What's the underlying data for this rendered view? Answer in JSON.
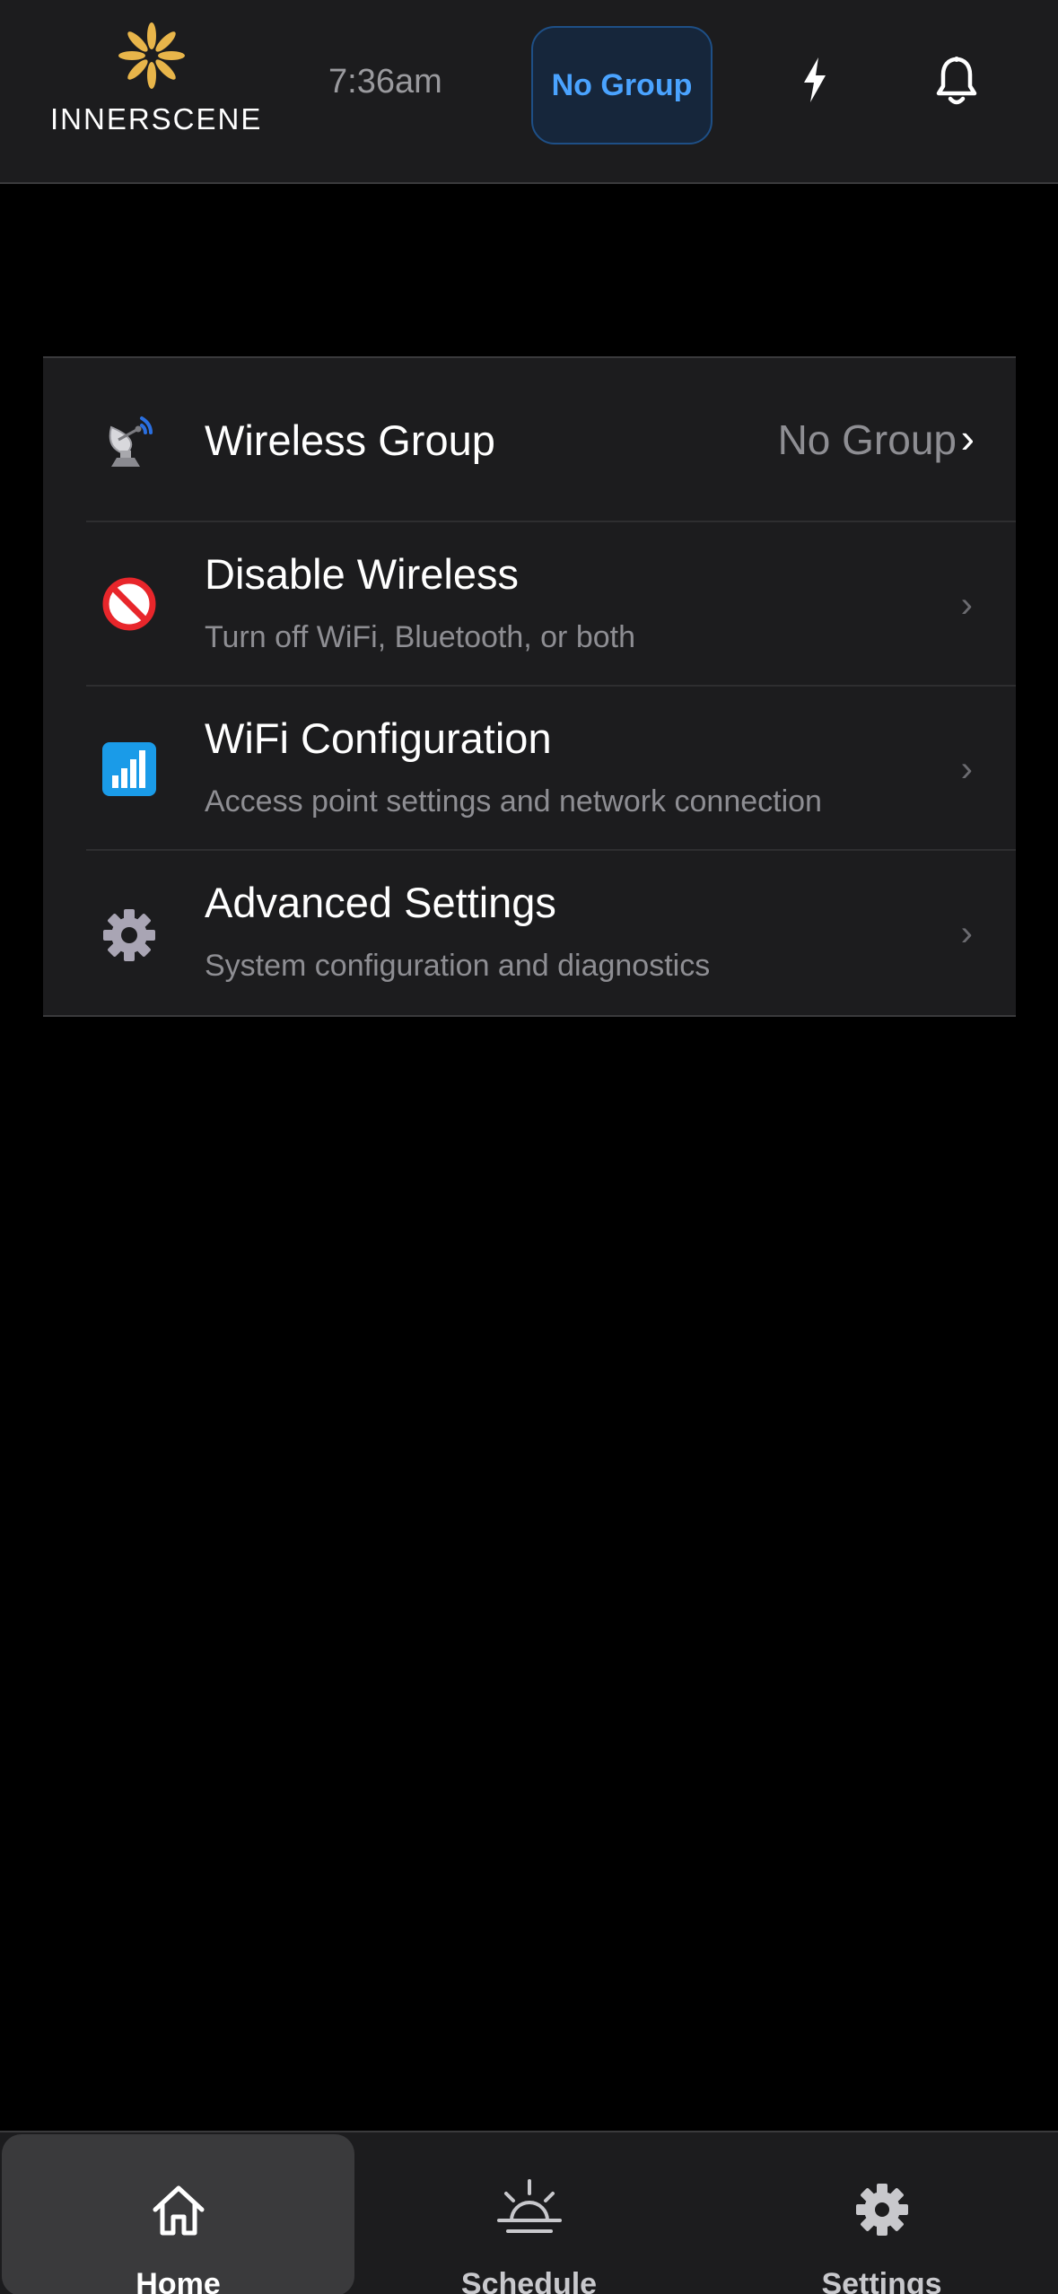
{
  "header": {
    "logo_text": "INNERSCENE",
    "time": "7:36am",
    "group_pill_label": "No Group"
  },
  "settings": {
    "items": [
      {
        "title": "Wireless Group",
        "subtitle": "",
        "value": "No Group",
        "icon": "satellite-dish-icon"
      },
      {
        "title": "Disable Wireless",
        "subtitle": "Turn off WiFi, Bluetooth, or both",
        "value": "",
        "icon": "no-entry-icon"
      },
      {
        "title": "WiFi Configuration",
        "subtitle": "Access point settings and network connection",
        "value": "",
        "icon": "signal-bars-icon"
      },
      {
        "title": "Advanced Settings",
        "subtitle": "System configuration and diagnostics",
        "value": "",
        "icon": "gear-icon"
      }
    ],
    "chevron": "›"
  },
  "tabbar": {
    "tabs": [
      {
        "label": "Home",
        "icon": "home-icon",
        "active": true
      },
      {
        "label": "Schedule",
        "icon": "sunrise-icon",
        "active": false
      },
      {
        "label": "Settings",
        "icon": "gear-icon",
        "active": false
      }
    ]
  },
  "colors": {
    "background": "#000000",
    "surface": "#1c1c1e",
    "accent": "#4aa3ff",
    "logo_gold": "#e8b54a",
    "no_entry_red": "#e8262b",
    "wifi_blue": "#1a9be8"
  }
}
